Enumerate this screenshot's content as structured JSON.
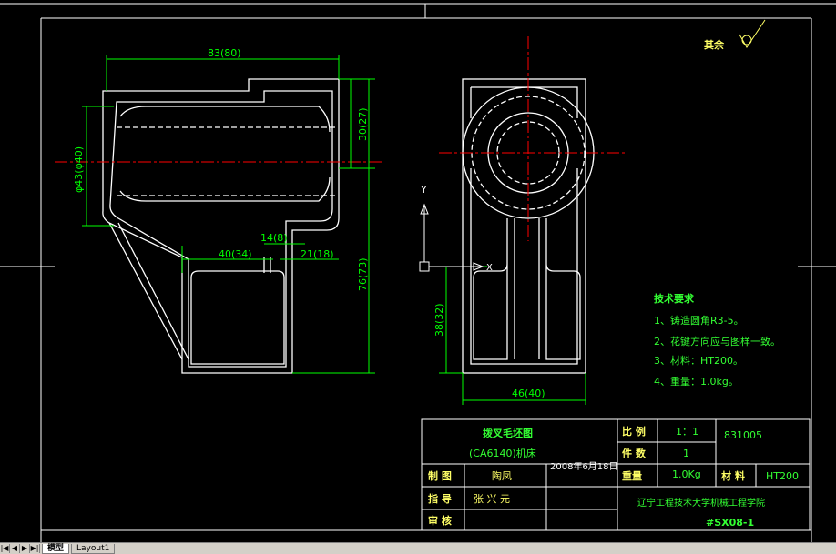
{
  "colors": {
    "background": "#000000",
    "line": "#ffffff",
    "dim": "#00ff00",
    "center": "#ff0000",
    "text_green": "#33ff33"
  },
  "dims": {
    "w83": "83(80)",
    "d43": "φ43(φ40)",
    "h30": "30(27)",
    "h76": "76(73)",
    "d40": "40(34)",
    "d14": "14(8)",
    "d21": "21(18)",
    "h38": "38(32)",
    "w46": "46(40)"
  },
  "ucs": {
    "y": "Y",
    "x": "X"
  },
  "roughness": {
    "label": "其余"
  },
  "notes": {
    "title": "技术要求",
    "items": [
      "1、铸造圆角R3-5。",
      "2、花键方向应与图样一致。",
      "3、材料：HT200。",
      "4、重量：1.0kg。"
    ]
  },
  "titleblock": {
    "name1": "拨叉毛坯图",
    "name2": "(CA6140)机床",
    "scale_label": "比 例",
    "scale_value": "1：1",
    "drawing_no": "831005",
    "qty_label": "件 数",
    "qty_value": "1",
    "weight_label": "重量",
    "weight_value": "1.0Kg",
    "material_label": "材 料",
    "material_value": "HT200",
    "draw_label": "制 图",
    "draw_name": "陶凤",
    "date": "2008年6月18日",
    "guide_label": "指 导",
    "guide_name": "张 兴 元",
    "review_label": "审 核",
    "school": "辽宁工程技术大学机械工程学院",
    "code": "#SX08-1"
  },
  "tabs": {
    "model": "模型",
    "layout": "Layout1"
  },
  "nav": {
    "first": "|◀",
    "prev": "◀",
    "next": "▶",
    "last": "▶|"
  }
}
